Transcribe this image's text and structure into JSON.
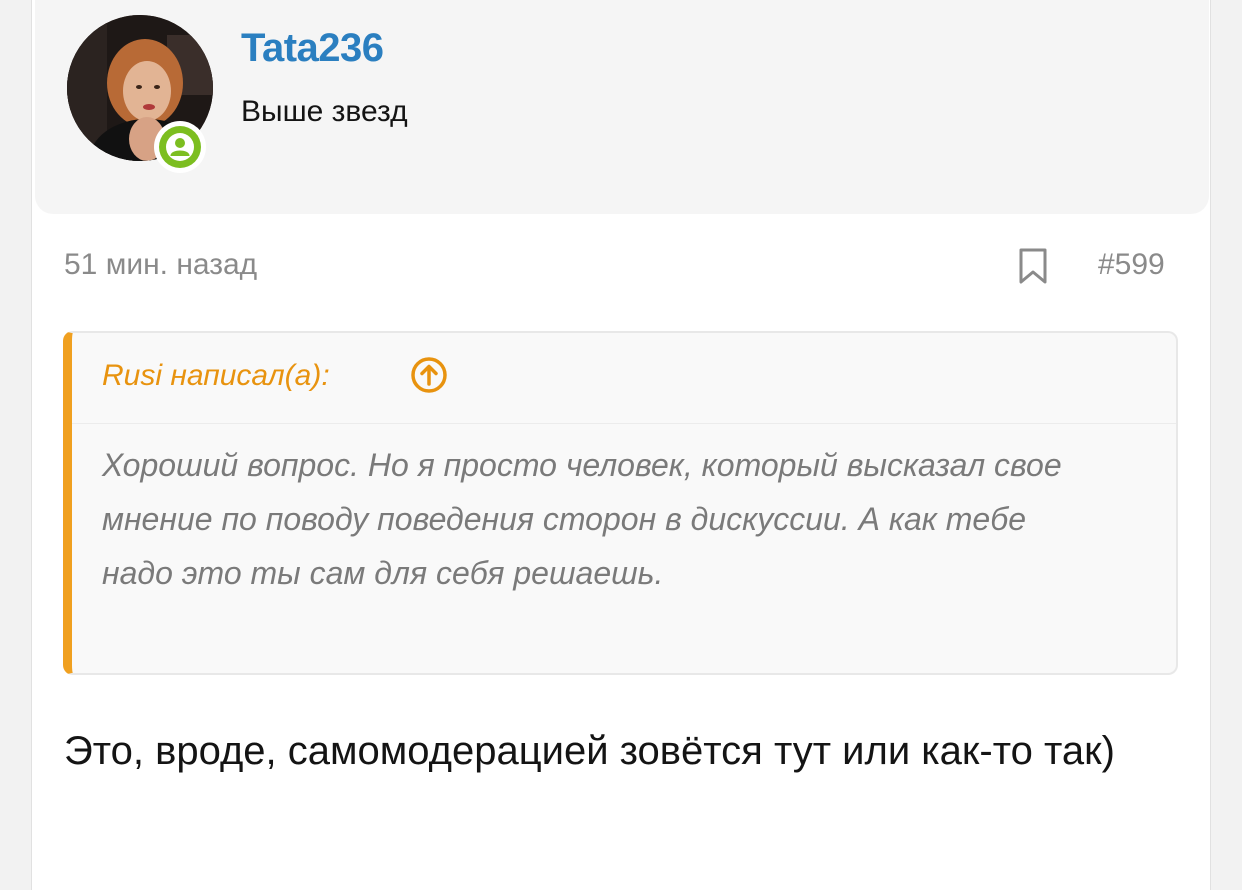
{
  "author": {
    "username": "Tata236",
    "user_title": "Выше звезд",
    "status": "online",
    "avatar_icon": "avatar-photo",
    "badge_icon": "user-icon",
    "name_color": "#2b7fc0",
    "badge_color": "#7cbe20"
  },
  "post": {
    "timestamp": "51 мин. назад",
    "bookmark_icon": "bookmark-icon",
    "number": "#599"
  },
  "quote": {
    "attribution": "Rusi написал(а):",
    "jump_icon": "arrow-up-circle-icon",
    "accent_color": "#f0a020",
    "text": "Хороший вопрос. Но я просто человек, который высказал свое мнение по поводу поведения сторон в дискуссии. А как тебе надо это ты сам для себя решаешь."
  },
  "message": {
    "text": "Это, вроде, самомодерацией зовётся тут или как-то так)"
  }
}
